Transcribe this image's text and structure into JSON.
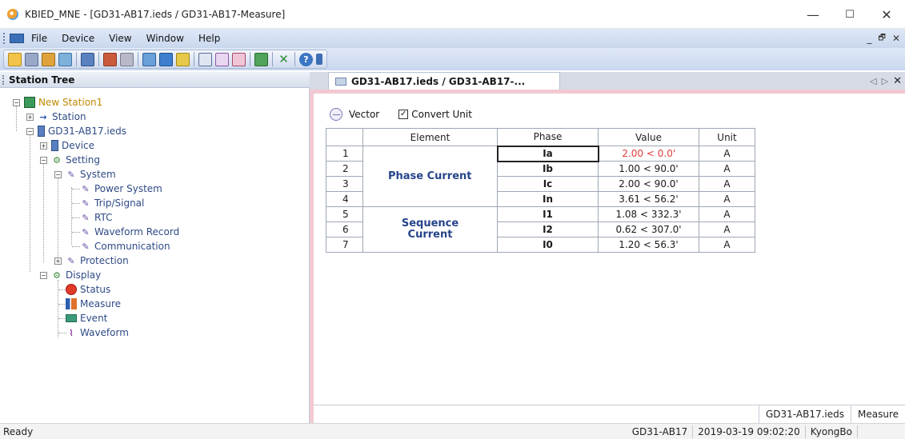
{
  "window": {
    "title": "KBIED_MNE - [GD31-AB17.ieds / GD31-AB17-Measure]",
    "minimize": "—",
    "maximize": "☐",
    "close": "✕"
  },
  "menu": {
    "items": [
      "File",
      "Device",
      "View",
      "Window",
      "Help"
    ],
    "mdi_min": "_",
    "mdi_restore": "🗗",
    "mdi_close": "✕"
  },
  "tree": {
    "header": "Station Tree",
    "nodes": {
      "station_root": "New Station1",
      "station": "Station",
      "device_file": "GD31-AB17.ieds",
      "device": "Device",
      "setting": "Setting",
      "system": "System",
      "power_system": "Power System",
      "trip_signal": "Trip/Signal",
      "rtc": "RTC",
      "waveform_record": "Waveform Record",
      "communication": "Communication",
      "protection": "Protection",
      "display": "Display",
      "status": "Status",
      "measure": "Measure",
      "event": "Event",
      "waveform": "Waveform"
    }
  },
  "doc": {
    "tab_title": "GD31-AB17.ieds / GD31-AB17-...",
    "tab_nav": {
      "left": "◁",
      "right": "▷",
      "close": "✕"
    },
    "options": {
      "vector_label": "Vector",
      "convert_unit_label": "Convert Unit",
      "convert_unit_checked": true
    },
    "grid": {
      "headers": {
        "element": "Element",
        "phase": "Phase",
        "value": "Value",
        "unit": "Unit"
      },
      "groups": {
        "phase_current": "Phase Current",
        "sequence_current": "Sequence Current"
      },
      "rows": [
        {
          "no": "1",
          "phase": "Ia",
          "value": "2.00 < 0.0'",
          "unit": "A"
        },
        {
          "no": "2",
          "phase": "Ib",
          "value": "1.00 < 90.0'",
          "unit": "A"
        },
        {
          "no": "3",
          "phase": "Ic",
          "value": "2.00 < 90.0'",
          "unit": "A"
        },
        {
          "no": "4",
          "phase": "In",
          "value": "3.61 < 56.2'",
          "unit": "A"
        },
        {
          "no": "5",
          "phase": "I1",
          "value": "1.08 < 332.3'",
          "unit": "A"
        },
        {
          "no": "6",
          "phase": "I2",
          "value": "0.62 < 307.0'",
          "unit": "A"
        },
        {
          "no": "7",
          "phase": "I0",
          "value": "1.20 < 56.3'",
          "unit": "A"
        }
      ],
      "highlight_value_color": "#e23b3b"
    },
    "bottom_tabs": [
      "GD31-AB17.ieds",
      "Measure"
    ]
  },
  "status": {
    "left": "Ready",
    "device": "GD31-AB17",
    "datetime": "2019-03-19 09:02:20",
    "user": "KyongBo"
  }
}
